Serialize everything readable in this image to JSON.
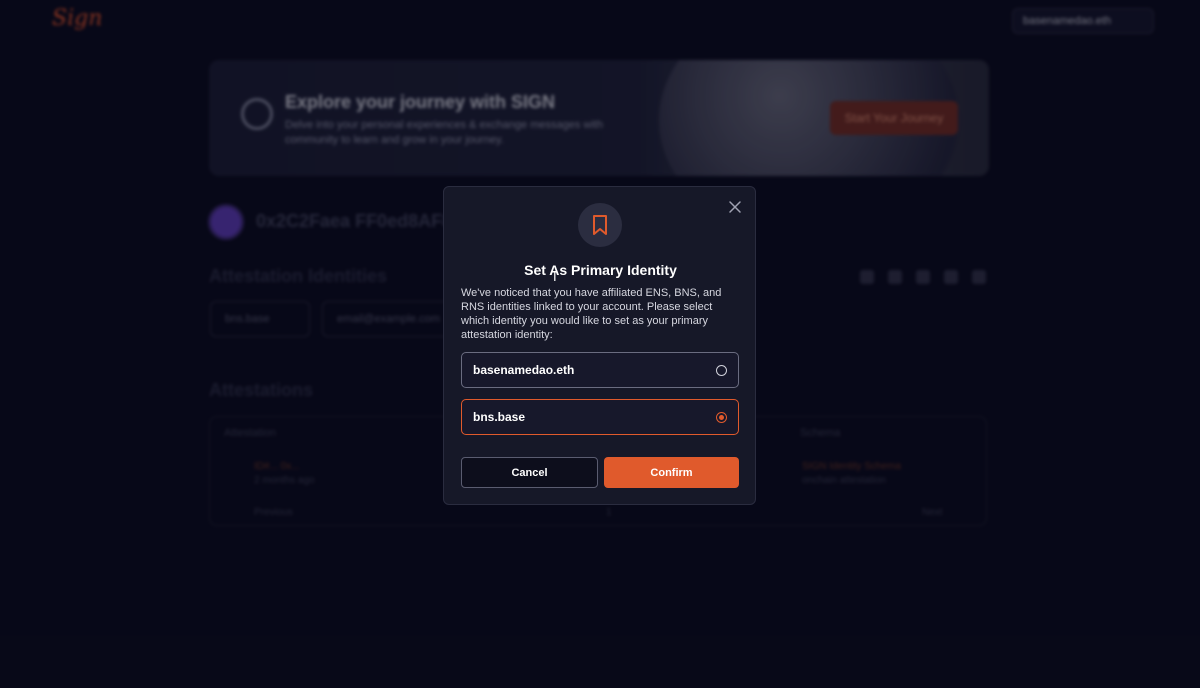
{
  "background": {
    "logo": "Sign",
    "wallet_label": "basenamedao.eth",
    "banner": {
      "title": "Explore your journey with SIGN",
      "subtitle": "Delve into your personal experiences & exchange messages with community to learn and grow in your journey.",
      "button": "Start Your Journey"
    },
    "address": "0x2C2Faea FF0ed8AF8",
    "attestation_identities_title": "Attestation Identities",
    "identity_chip_1": "bns.base",
    "identity_chip_2": "email@example.com",
    "attestations_title": "Attestations",
    "table": {
      "col_attestation": "Attestation",
      "col_schema": "Schema",
      "row_id": "ID#... 0x...",
      "row_time": "2 months ago",
      "row_schema": "SIGN Identity Schema",
      "row_schema_sub": "onchain attestation",
      "prev": "Previous",
      "page": "1",
      "next": "Next"
    }
  },
  "modal": {
    "icon": "bookmark-icon",
    "title": "Set As Primary Identity",
    "description": "We've noticed that you have affiliated ENS, BNS, and RNS identities linked to your account. Please select which identity you would like to set as your primary attestation identity:",
    "options": [
      {
        "label": "basenamedao.eth",
        "selected": false
      },
      {
        "label": "bns.base",
        "selected": true
      }
    ],
    "cancel_label": "Cancel",
    "confirm_label": "Confirm"
  },
  "colors": {
    "accent": "#e05a2c",
    "background": "#090a1c",
    "modal_bg": "#161828"
  }
}
